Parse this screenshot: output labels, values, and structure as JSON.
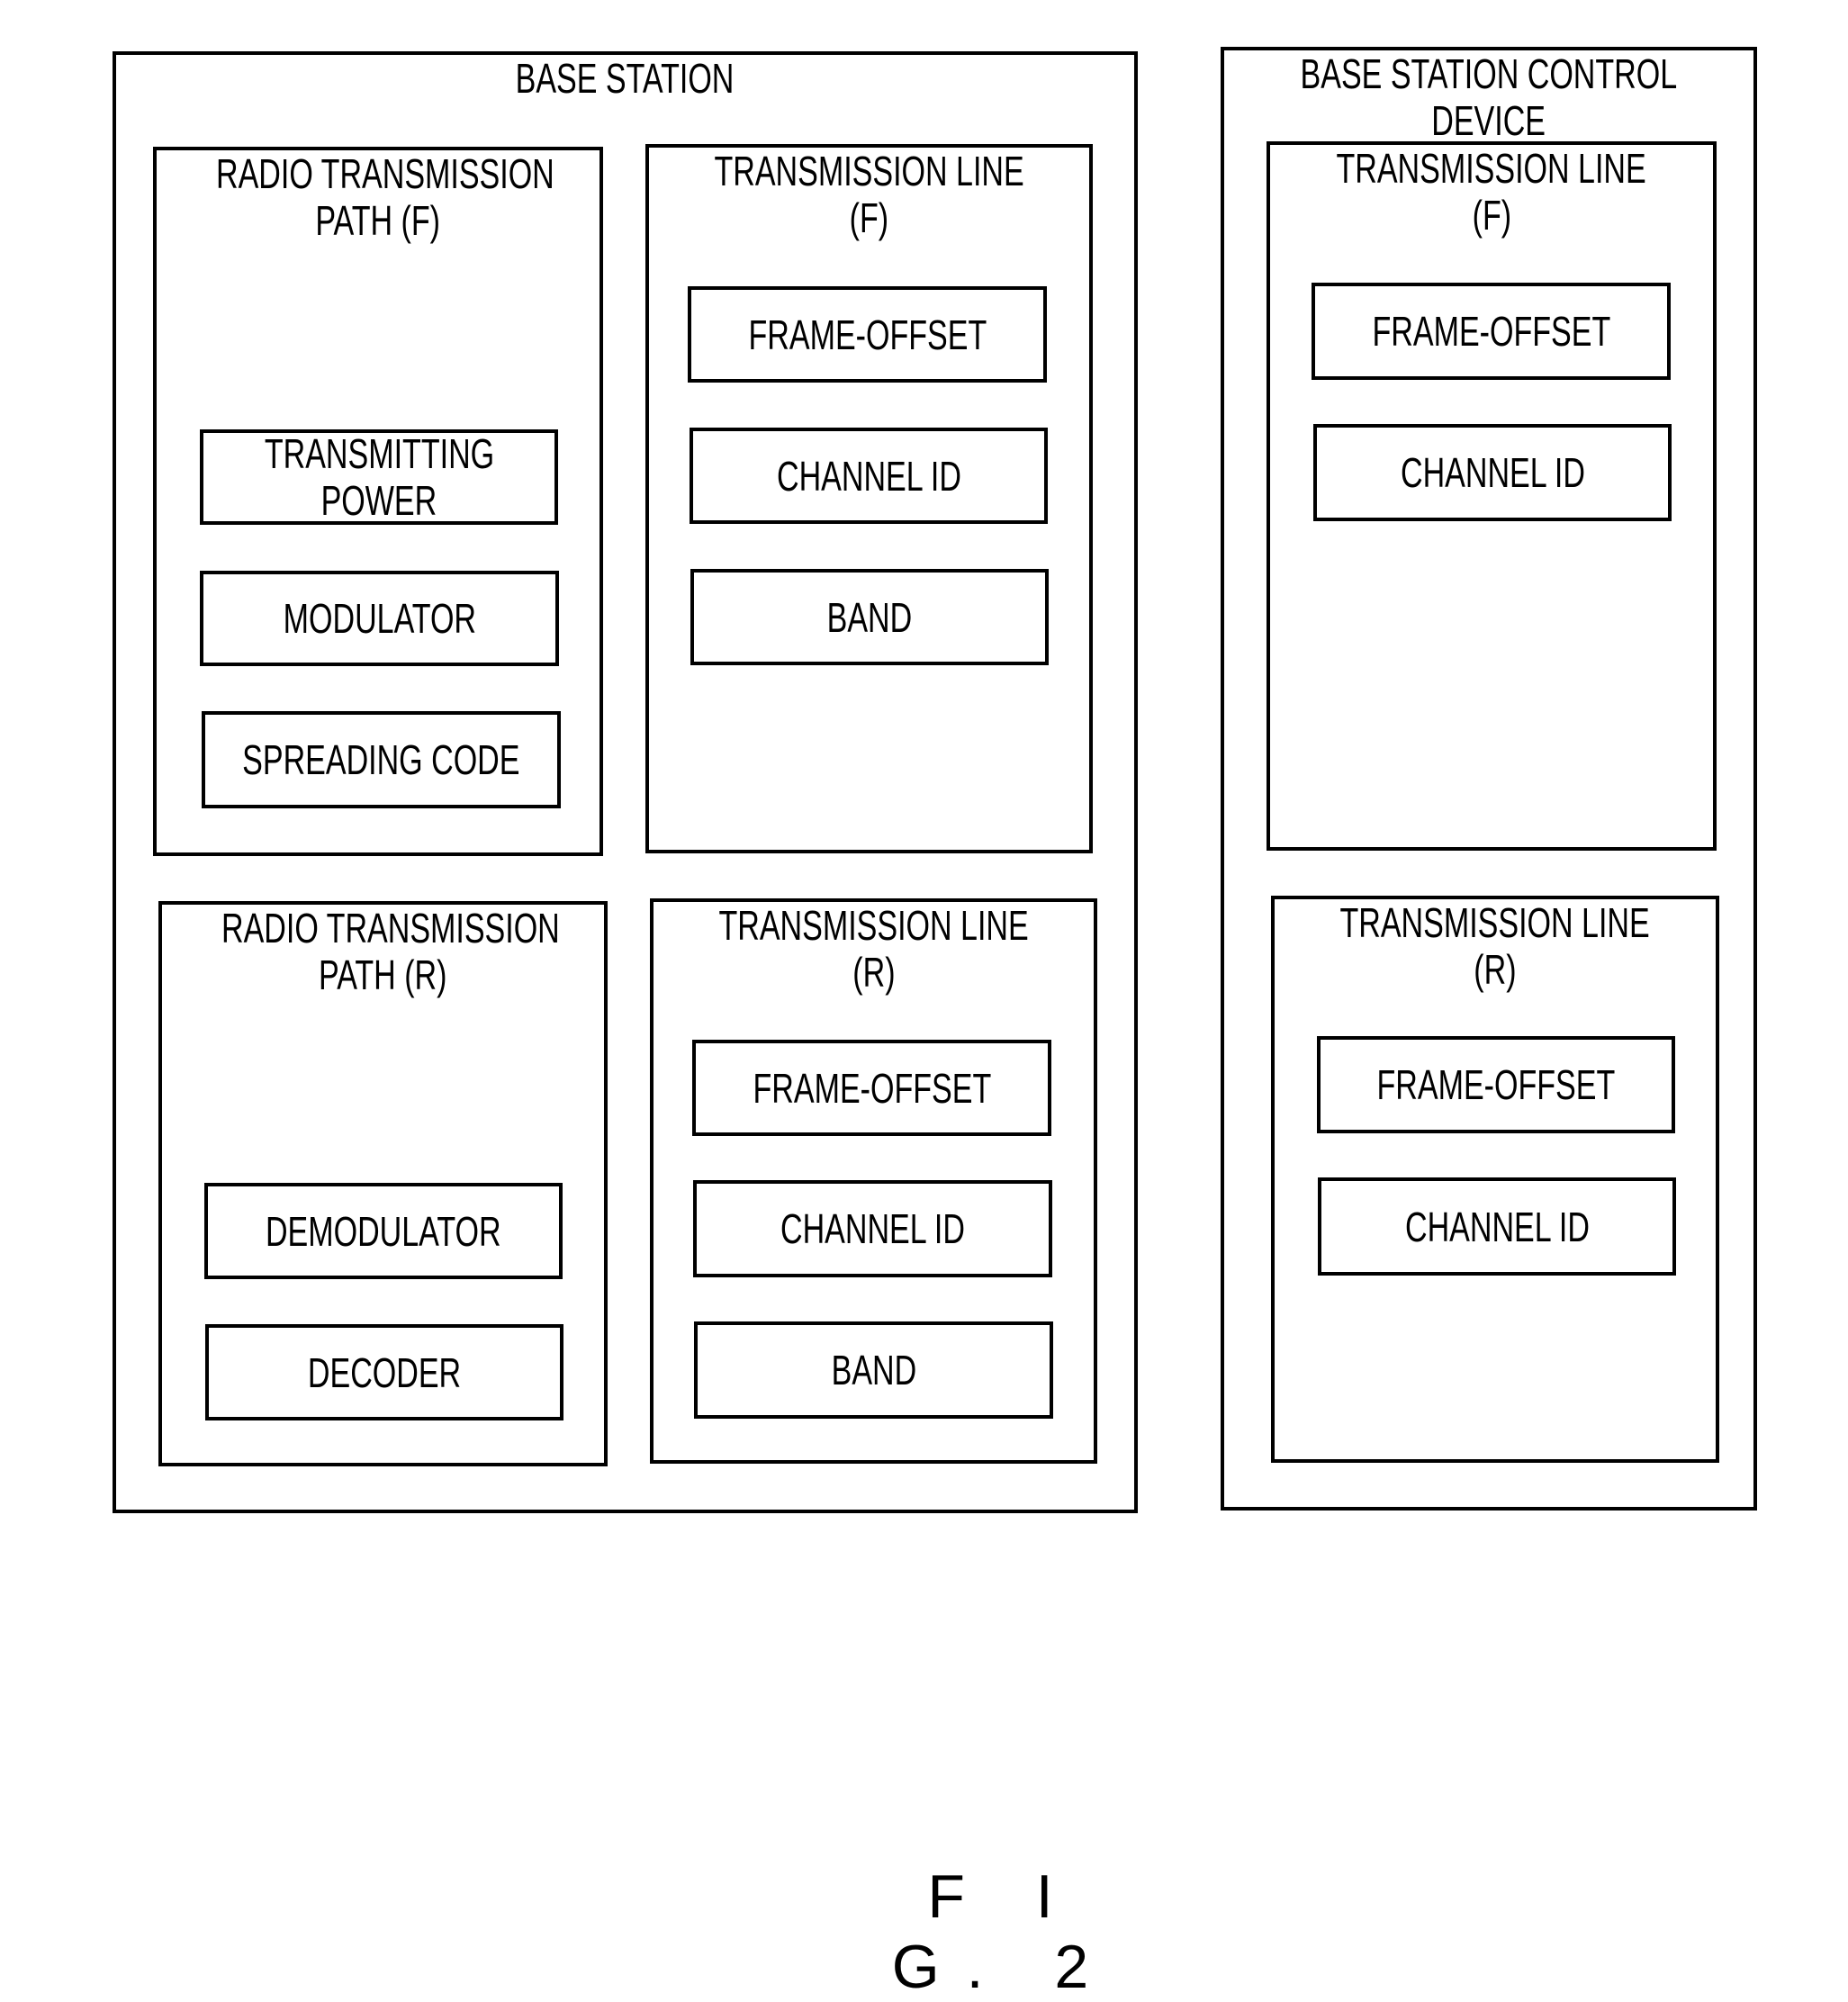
{
  "figure_label": "F I G. 2",
  "base_station": {
    "title": "BASE STATION",
    "radio_transmission_path_f": {
      "title_line1": "RADIO TRANSMISSION",
      "title_line2": "PATH (F)",
      "items": [
        {
          "line1": "TRANSMITTING",
          "line2": "POWER"
        },
        {
          "line1": "MODULATOR"
        },
        {
          "line1": "SPREADING CODE"
        }
      ]
    },
    "transmission_line_f": {
      "title_line1": "TRANSMISSION LINE",
      "title_line2": "(F)",
      "items": [
        {
          "line1": "FRAME-OFFSET"
        },
        {
          "line1": "CHANNEL ID"
        },
        {
          "line1": "BAND"
        }
      ]
    },
    "radio_transmission_path_r": {
      "title_line1": "RADIO TRANSMISSION",
      "title_line2": "PATH (R)",
      "items": [
        {
          "line1": "DEMODULATOR"
        },
        {
          "line1": "DECODER"
        }
      ]
    },
    "transmission_line_r": {
      "title_line1": "TRANSMISSION LINE",
      "title_line2": "(R)",
      "items": [
        {
          "line1": "FRAME-OFFSET"
        },
        {
          "line1": "CHANNEL ID"
        },
        {
          "line1": "BAND"
        }
      ]
    }
  },
  "base_station_control_device": {
    "title_line1": "BASE STATION CONTROL",
    "title_line2": "DEVICE",
    "transmission_line_f": {
      "title_line1": "TRANSMISSION LINE",
      "title_line2": "(F)",
      "items": [
        {
          "line1": "FRAME-OFFSET"
        },
        {
          "line1": "CHANNEL ID"
        }
      ]
    },
    "transmission_line_r": {
      "title_line1": "TRANSMISSION LINE",
      "title_line2": "(R)",
      "items": [
        {
          "line1": "FRAME-OFFSET"
        },
        {
          "line1": "CHANNEL ID"
        }
      ]
    }
  }
}
